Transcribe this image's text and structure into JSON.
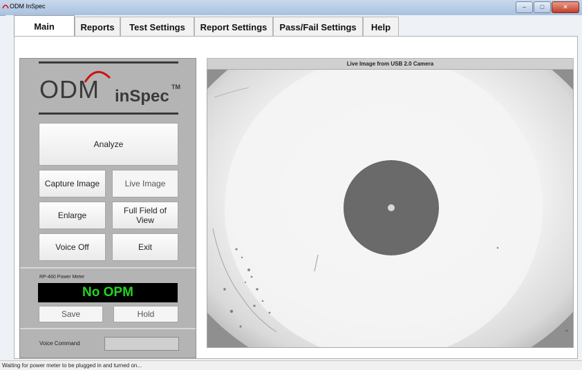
{
  "window": {
    "title": "ODM InSpec",
    "controls": [
      "–",
      "□",
      "✕"
    ]
  },
  "tabs": [
    {
      "label": "Main",
      "active": true
    },
    {
      "label": "Reports"
    },
    {
      "label": "Test Settings"
    },
    {
      "label": "Report Settings"
    },
    {
      "label": "Pass/Fail Settings"
    },
    {
      "label": "Help"
    }
  ],
  "logo": {
    "odm": "ODM",
    "inspec": "inSpec",
    "tm": "TM"
  },
  "buttons": {
    "analyze": "Analyze",
    "capture_image": "Capture Image",
    "live_image": "Live Image",
    "enlarge": "Enlarge",
    "full_field": "Full Field of View",
    "voice_off": "Voice Off",
    "exit": "Exit",
    "save": "Save",
    "hold": "Hold"
  },
  "power_meter": {
    "label": "RP-460 Power Meter",
    "reading": "No OPM",
    "reading_color": "#22d322"
  },
  "voice_command": {
    "label": "Voice Command",
    "value": ""
  },
  "camera": {
    "header": "Live Image from USB 2.0 Camera",
    "overlay_text": "",
    "overlay_color": "#c7f03c"
  },
  "status": {
    "text": "Waiting for power meter to be plugged in and turned on..."
  },
  "colors": {
    "accent": "#22d322",
    "panel": "#b4b4b4",
    "logo_red": "#d01010"
  }
}
